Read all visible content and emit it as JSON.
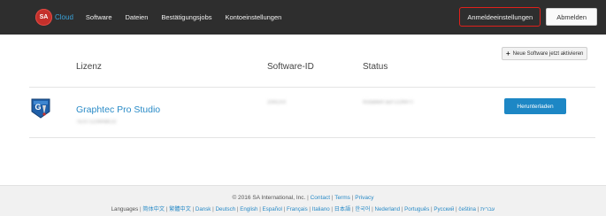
{
  "navbar": {
    "logo_text": "SA",
    "brand_suffix": "Cloud",
    "links": [
      "Software",
      "Dateien",
      "Bestätigungsjobs",
      "Kontoeinstellungen"
    ],
    "account_settings": "Anmeldeeinstellungen",
    "logout": "Abmelden"
  },
  "actions": {
    "activate_new": "Neue Software jetzt aktivieren"
  },
  "table": {
    "headers": {
      "license": "Lizenz",
      "software_id": "Software-ID",
      "status": "Status"
    },
    "rows": [
      {
        "name": "Graphtec Pro Studio",
        "license_code": "TEST1234ABCD",
        "software_id": "2041XX",
        "status": "Installiert auf CONFIT",
        "download": "Herunterladen"
      }
    ]
  },
  "footer": {
    "copyright": "© 2016 SA International, Inc.",
    "links": [
      "Contact",
      "Terms",
      "Privacy"
    ],
    "languages_label": "Languages",
    "languages": [
      "简体中文",
      "繁體中文",
      "Dansk",
      "Deutsch",
      "English",
      "Español",
      "Français",
      "Italiano",
      "日本語",
      "한국어",
      "Nederland",
      "Português",
      "Русский",
      "čeština",
      "עברית"
    ]
  },
  "colors": {
    "navbar": "#2e2e2e",
    "accent": "#1d87c5",
    "highlight": "#e0201b"
  }
}
